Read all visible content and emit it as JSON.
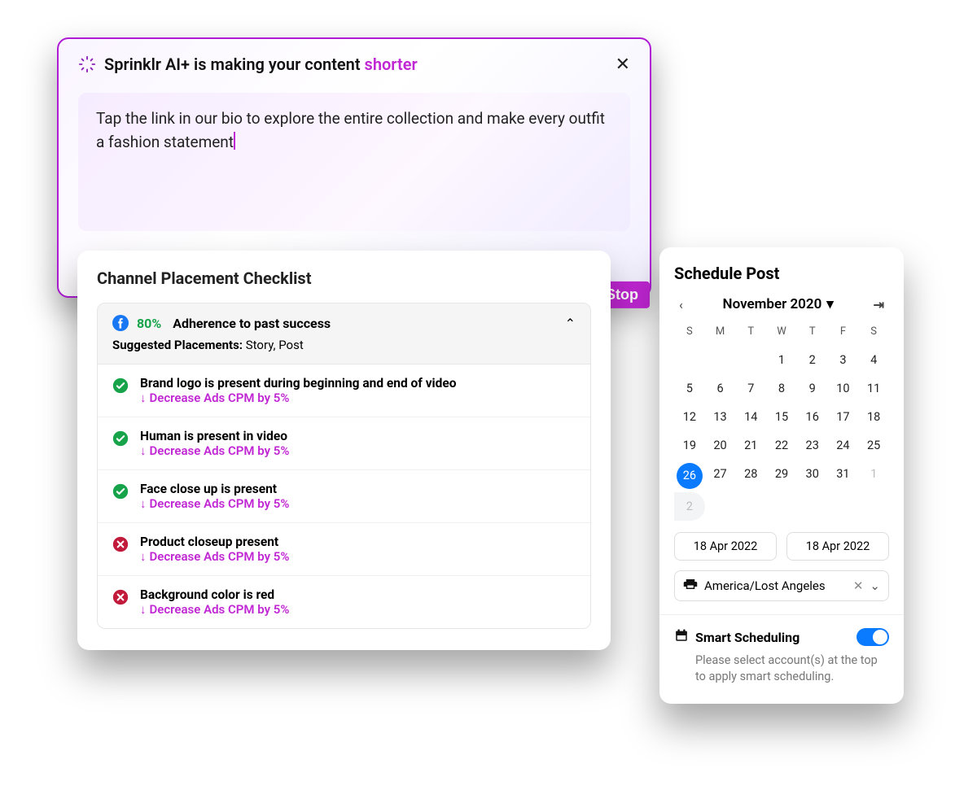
{
  "ai": {
    "title_prefix": "Sprinklr AI+ is making your content ",
    "title_accent": "shorter",
    "body": "Tap the link in our bio to explore the entire collection and make every outfit a fashion statement",
    "stop": "Stop"
  },
  "checklist": {
    "title": "Channel Placement Checklist",
    "percent": "80%",
    "adherence": "Adherence to past success",
    "suggested_label": "Suggested Placements:",
    "suggested_value": "Story, Post",
    "items": [
      {
        "ok": true,
        "text": "Brand logo is present during beginning and end of video",
        "sub": "Decrease Ads CPM by 5%"
      },
      {
        "ok": true,
        "text": "Human is present in video",
        "sub": "Decrease Ads CPM by 5%"
      },
      {
        "ok": true,
        "text": "Face close up is present",
        "sub": "Decrease Ads CPM by 5%"
      },
      {
        "ok": false,
        "text": "Product closeup present",
        "sub": "Decrease Ads CPM by 5%"
      },
      {
        "ok": false,
        "text": "Background color is red",
        "sub": "Decrease Ads CPM by 5%"
      }
    ]
  },
  "schedule": {
    "title": "Schedule Post",
    "month": "November 2020",
    "dow": [
      "S",
      "M",
      "T",
      "W",
      "T",
      "F",
      "S"
    ],
    "leading_blanks": 3,
    "days": 31,
    "trailing": [
      1,
      2
    ],
    "selected": 26,
    "date_a": "18 Apr 2022",
    "date_b": "18 Apr 2022",
    "tz": "America/Lost Angeles",
    "smart_label": "Smart Scheduling",
    "smart_sub": "Please select account(s) at the top to apply smart scheduling."
  }
}
